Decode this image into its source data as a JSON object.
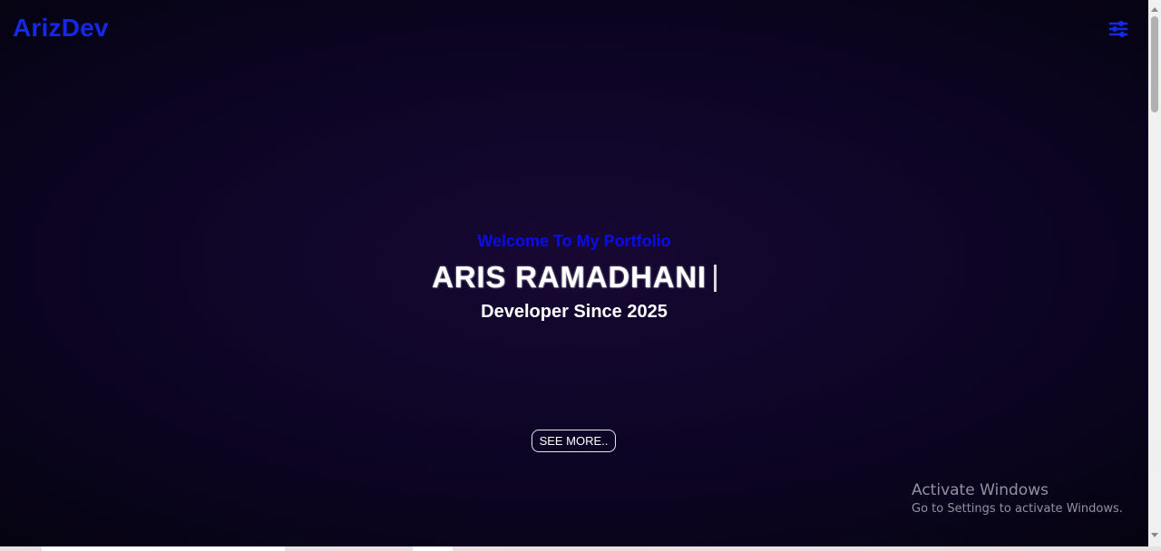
{
  "header": {
    "logo": "ArizDev",
    "menu_icon": "sliders-icon"
  },
  "hero": {
    "welcome": "Welcome To My Portfolio",
    "name": "ARIS RAMADHANI",
    "tagline": "Developer Since 2025",
    "cta_label": "SEE MORE.."
  },
  "watermark": {
    "title": "Activate Windows",
    "subtitle": "Go to Settings to activate Windows."
  },
  "colors": {
    "accent": "#1428e8",
    "background": "#10062a",
    "text": "#ffffff"
  }
}
